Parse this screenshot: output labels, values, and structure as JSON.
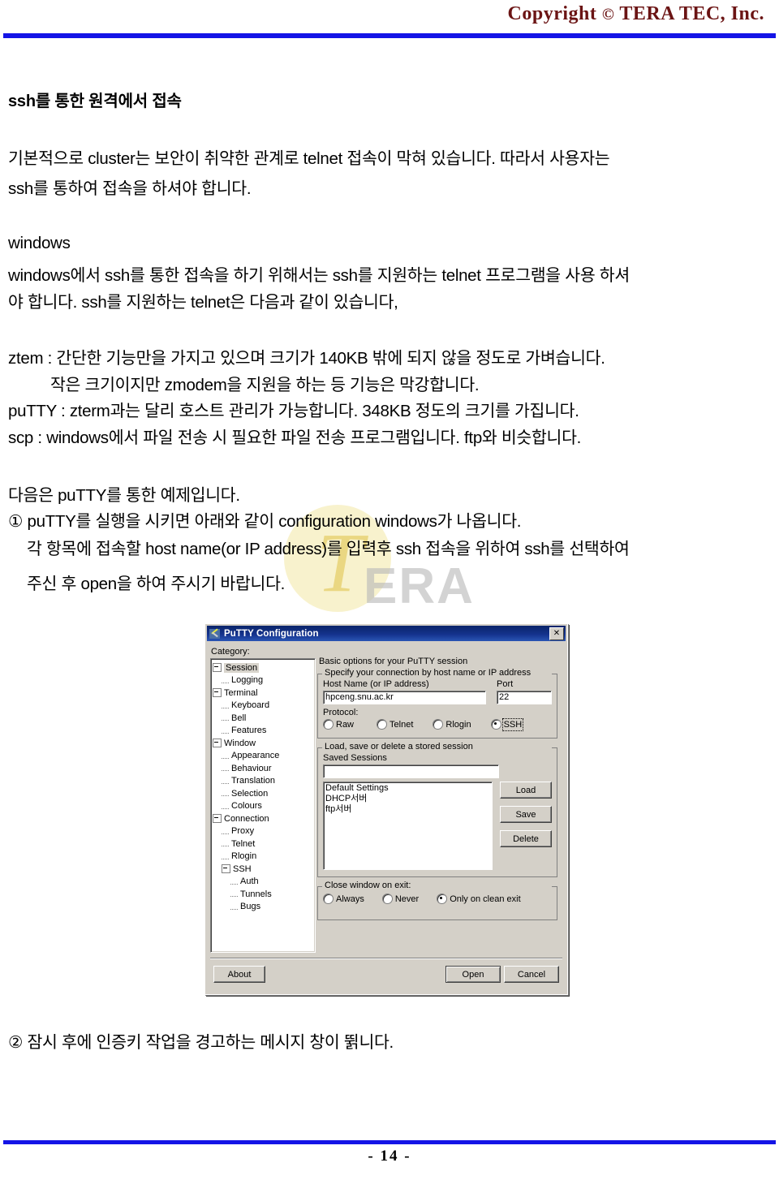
{
  "header": {
    "copyright_prefix": "Copyright",
    "copyright_mark": "©",
    "copyright_company": "TERA  TEC, Inc.",
    "rule_color": "#1414e6"
  },
  "footer": {
    "page_number": "- 14 -"
  },
  "watermark": {
    "letter": "T",
    "word": "ERA",
    "circle_color": "#f7f0c4",
    "word_color": "#b9b9b9"
  },
  "document": {
    "section_title": "ssh를 통한 원격에서 접속",
    "paragraphs": [
      "기본적으로 cluster는 보안이 취약한 관계로 telnet 접속이 막혀 있습니다. 따라서 사용자는",
      "ssh를 통하여 접속을 하셔야 합니다.",
      "windows",
      "windows에서 ssh를 통한 접속을 하기 위해서는 ssh를 지원하는 telnet 프로그램을 사용 하셔",
      "야 합니다. ssh를 지원하는 telnet은 다음과 같이 있습니다,",
      "ztem : 간단한 기능만을 가지고 있으며 크기가 140KB 밖에 되지 않을 정도로 가벼습니다.",
      "작은 크기이지만 zmodem을 지원을 하는 등 기능은 막강합니다.",
      "puTTY : zterm과는 달리 호스트 관리가 가능합니다. 348KB 정도의 크기를 가집니다.",
      "scp : windows에서 파일 전송 시 필요한 파일 전송 프로그램입니다. ftp와 비슷합니다.",
      "다음은 puTTY를 통한 예제입니다.",
      "① puTTY를 실행을 시키면 아래와 같이 configuration windows가 나옵니다.",
      "각 항목에 접속할 host name(or IP address)를 입력후 ssh 접속을 위하여 ssh를 선택하여",
      "주신 후 open을 하여 주시기 바랍니다.",
      "② 잠시 후에 인증키 작업을 경고하는 메시지 창이 뛹니다."
    ]
  },
  "putty_dialog": {
    "title": "PuTTY Configuration",
    "close_label": "✕",
    "category_label": "Category:",
    "tree": [
      {
        "label": "Session",
        "level": 0,
        "expander": true,
        "selected": true
      },
      {
        "label": "Logging",
        "level": 1,
        "expander": false,
        "selected": false
      },
      {
        "label": "Terminal",
        "level": 0,
        "expander": true,
        "selected": false
      },
      {
        "label": "Keyboard",
        "level": 1,
        "expander": false,
        "selected": false
      },
      {
        "label": "Bell",
        "level": 1,
        "expander": false,
        "selected": false
      },
      {
        "label": "Features",
        "level": 1,
        "expander": false,
        "selected": false
      },
      {
        "label": "Window",
        "level": 0,
        "expander": true,
        "selected": false
      },
      {
        "label": "Appearance",
        "level": 1,
        "expander": false,
        "selected": false
      },
      {
        "label": "Behaviour",
        "level": 1,
        "expander": false,
        "selected": false
      },
      {
        "label": "Translation",
        "level": 1,
        "expander": false,
        "selected": false
      },
      {
        "label": "Selection",
        "level": 1,
        "expander": false,
        "selected": false
      },
      {
        "label": "Colours",
        "level": 1,
        "expander": false,
        "selected": false
      },
      {
        "label": "Connection",
        "level": 0,
        "expander": true,
        "selected": false
      },
      {
        "label": "Proxy",
        "level": 1,
        "expander": false,
        "selected": false
      },
      {
        "label": "Telnet",
        "level": 1,
        "expander": false,
        "selected": false
      },
      {
        "label": "Rlogin",
        "level": 1,
        "expander": false,
        "selected": false
      },
      {
        "label": "SSH",
        "level": 1,
        "expander": true,
        "selected": false
      },
      {
        "label": "Auth",
        "level": 2,
        "expander": false,
        "selected": false
      },
      {
        "label": "Tunnels",
        "level": 2,
        "expander": false,
        "selected": false
      },
      {
        "label": "Bugs",
        "level": 2,
        "expander": false,
        "selected": false
      }
    ],
    "pane_title": "Basic options for your PuTTY session",
    "connection_group": {
      "legend": "Specify your connection by host name or IP address",
      "host_label": "Host Name (or IP address)",
      "host_value": "hpceng.snu.ac.kr",
      "port_label": "Port",
      "port_value": "22",
      "protocol_label": "Protocol:",
      "protocols": [
        {
          "label": "Raw",
          "selected": false
        },
        {
          "label": "Telnet",
          "selected": false
        },
        {
          "label": "Rlogin",
          "selected": false
        },
        {
          "label": "SSH",
          "selected": true
        }
      ]
    },
    "sessions_group": {
      "legend": "Load, save or delete a stored session",
      "saved_label": "Saved Sessions",
      "saved_value": "",
      "items": [
        "Default Settings",
        "DHCP서버",
        "ftp서버"
      ],
      "buttons": [
        "Load",
        "Save",
        "Delete"
      ]
    },
    "exit_group": {
      "label": "Close window on exit:",
      "options": [
        {
          "label": "Always",
          "selected": false
        },
        {
          "label": "Never",
          "selected": false
        },
        {
          "label": "Only on clean exit",
          "selected": true
        }
      ]
    },
    "about_label": "About",
    "open_label": "Open",
    "cancel_label": "Cancel"
  }
}
